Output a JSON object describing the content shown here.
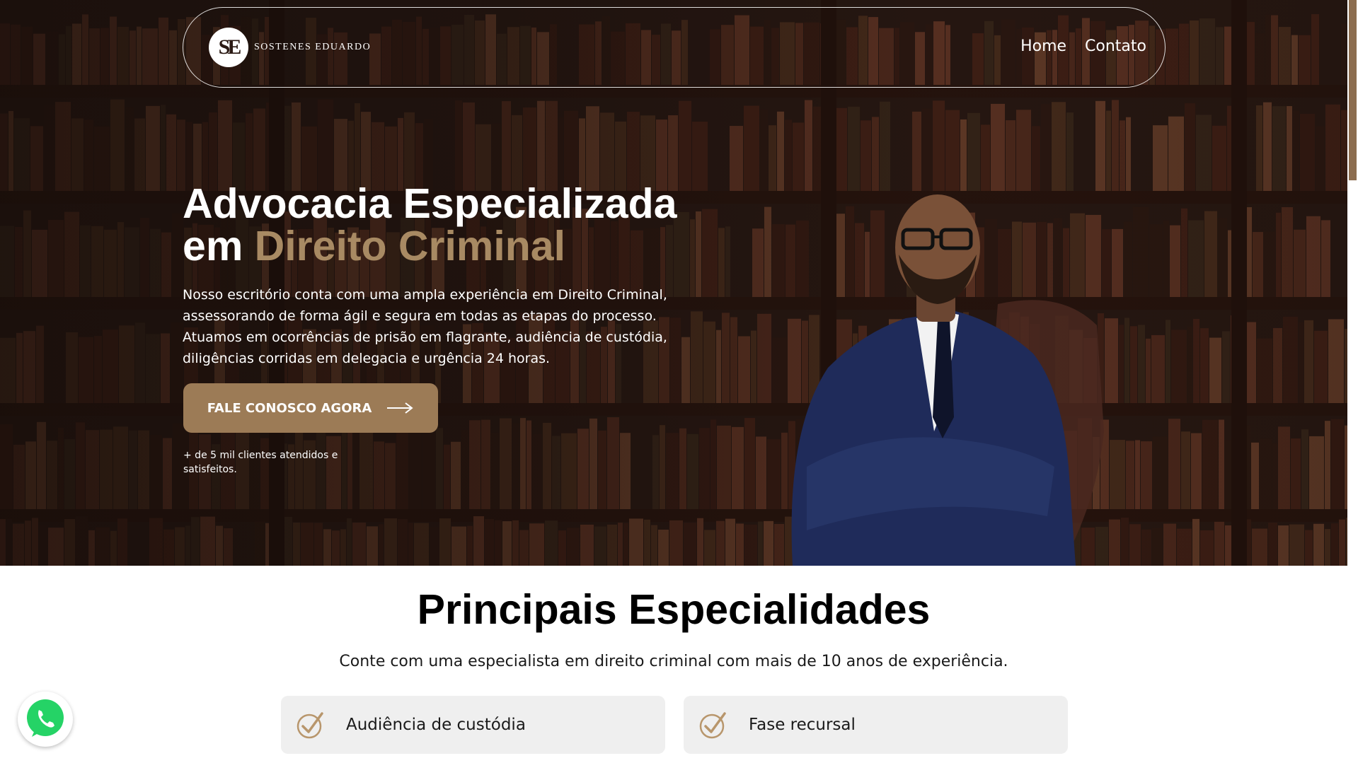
{
  "brand": {
    "logo_mark": "SE",
    "name": "SOSTENES EDUARDO"
  },
  "nav": {
    "home": "Home",
    "contact": "Contato"
  },
  "hero": {
    "title_line1": "Advocacia Especializada",
    "title_line2_prefix": "em ",
    "title_line2_accent": "Direito Criminal",
    "description": "Nosso escritório conta com uma ampla experiência em Direito Criminal, assessorando de forma ágil e segura em todas as etapas do processo. Atuamos em ocorrências de prisão em flagrante, audiência de custódia, diligências corridas em delegacia e urgência 24 horas.",
    "cta_label": "FALE CONOSCO AGORA",
    "note": "+ de 5 mil clientes atendidos e satisfeitos."
  },
  "section": {
    "title": "Principais Especialidades",
    "subtitle": "Conte com uma especialista em direito criminal com mais de 10 anos de experiência.",
    "cards": [
      {
        "label": "Audiência de custódia",
        "icon": "check-circle-icon"
      },
      {
        "label": "Fase recursal",
        "icon": "check-circle-icon"
      }
    ]
  },
  "colors": {
    "accent": "#a88a63",
    "cta": "#9c7b56",
    "card_bg": "#efefef",
    "whatsapp": "#25d366"
  }
}
